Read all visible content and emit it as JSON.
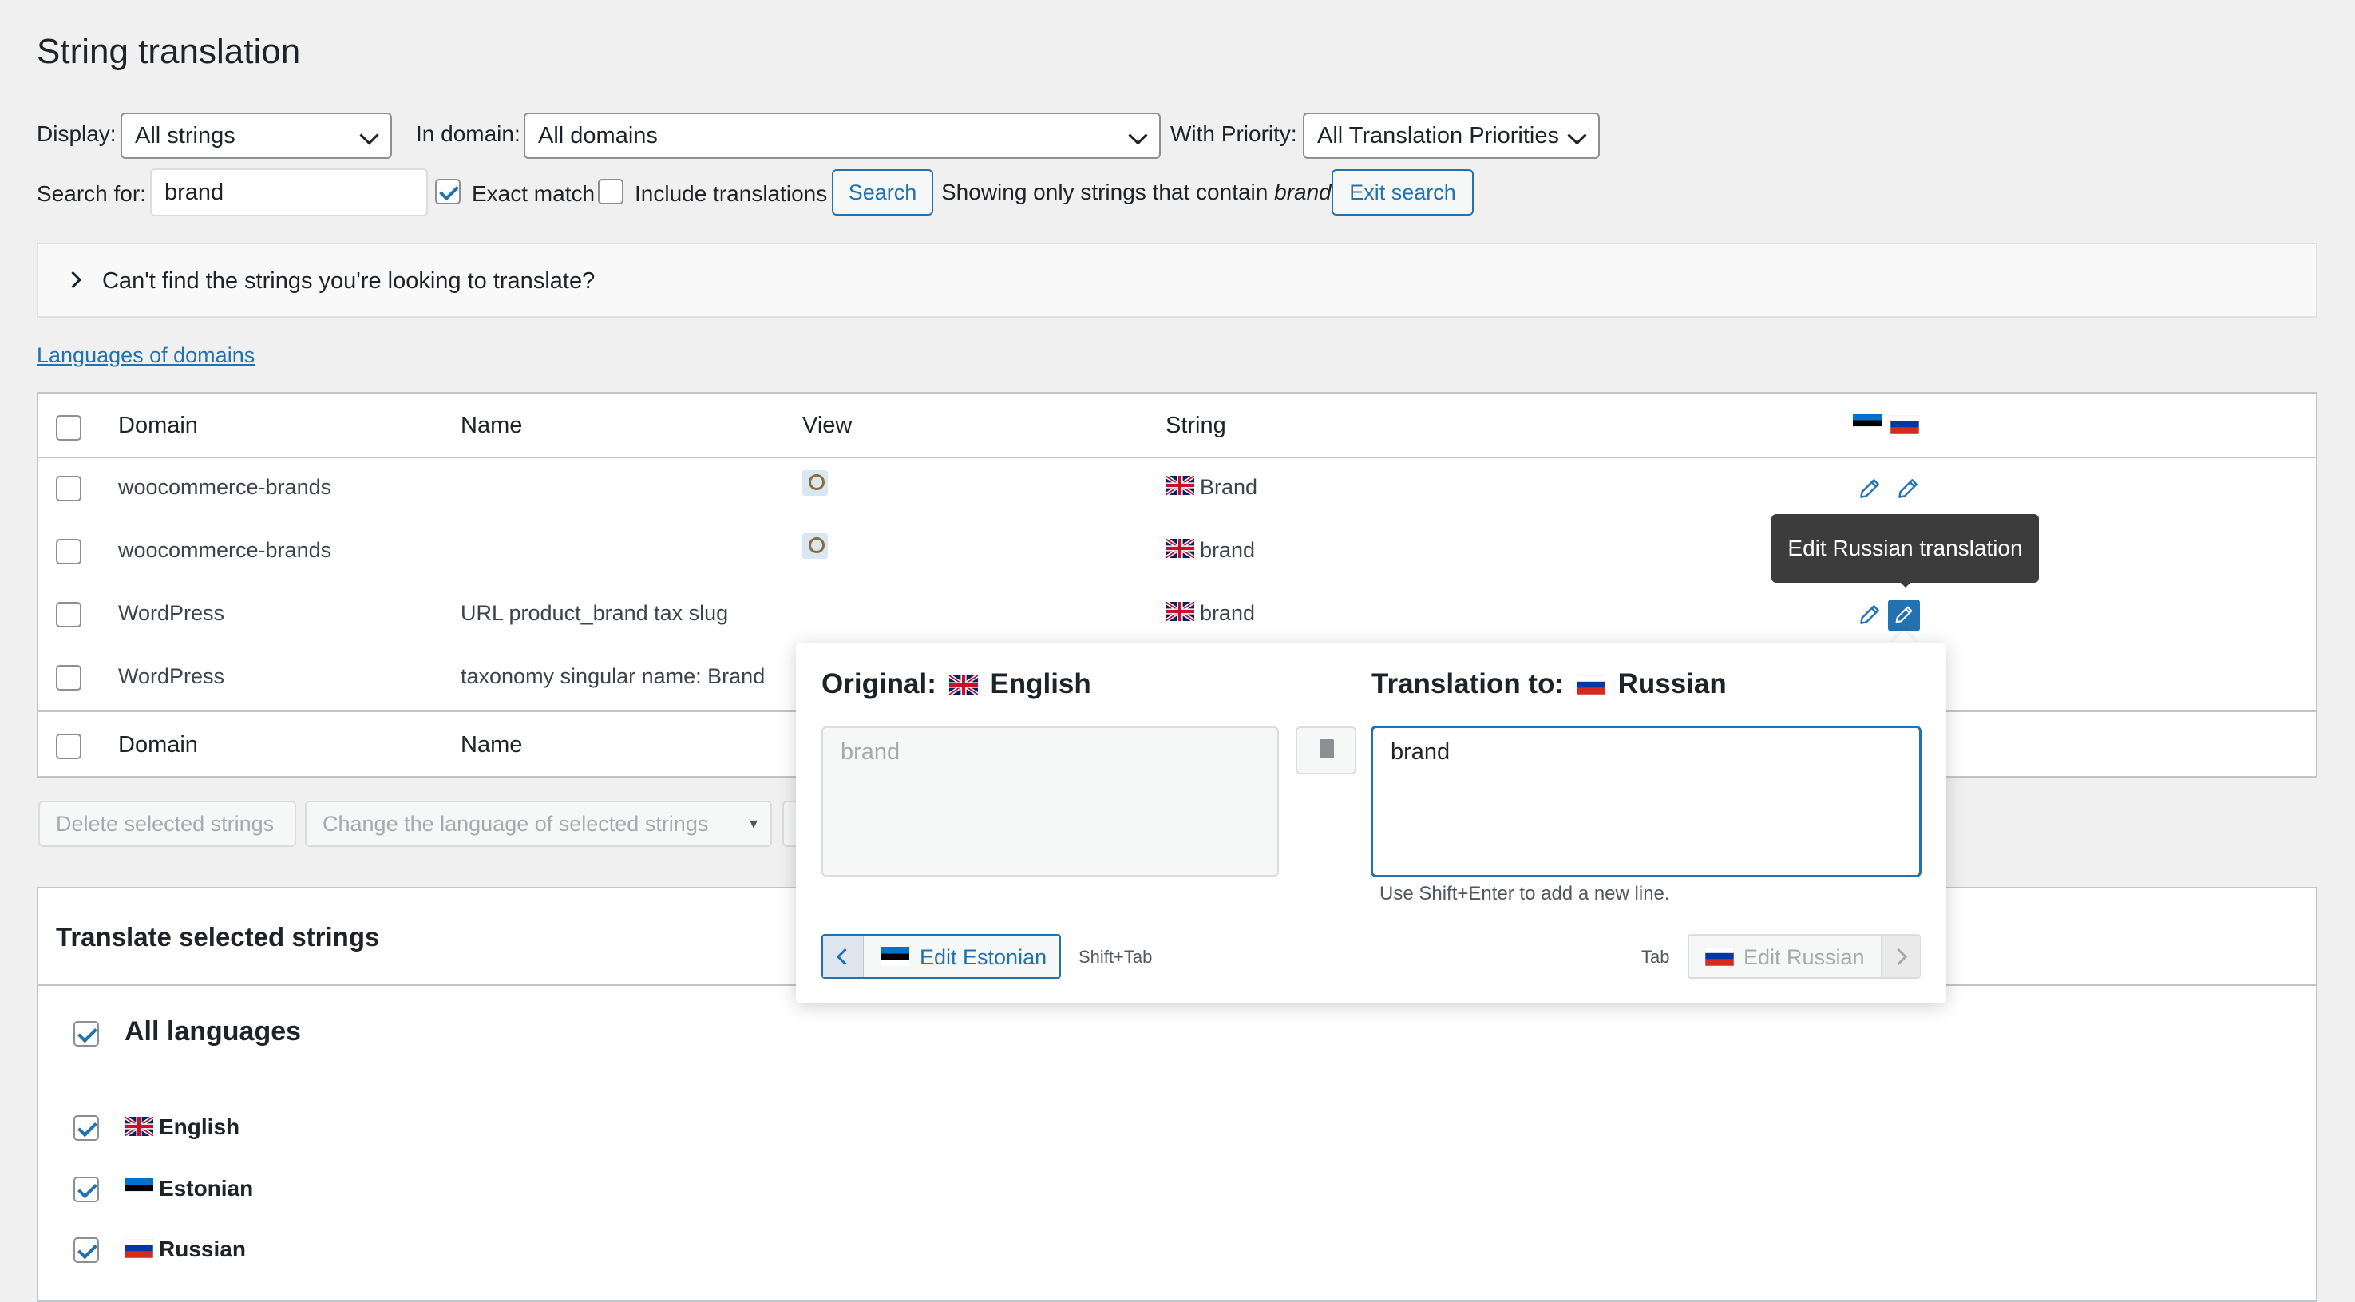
{
  "page": {
    "title": "String translation"
  },
  "filters": {
    "display_label": "Display:",
    "display_value": "All strings",
    "domain_label": "In domain:",
    "domain_value": "All domains",
    "priority_label": "With Priority:",
    "priority_value": "All Translation Priorities",
    "search_label": "Search for:",
    "search_value": "brand",
    "exact_match_label": "Exact match",
    "include_translations_label": "Include translations",
    "search_button": "Search",
    "showing_prefix": "Showing only strings that contain",
    "showing_term": "brand",
    "exit_search_button": "Exit search"
  },
  "cant_find": {
    "text": "Can't find the strings you're looking to translate?"
  },
  "languages_link": "Languages of domains",
  "table": {
    "headers": {
      "domain": "Domain",
      "name": "Name",
      "view": "View",
      "string": "String"
    },
    "rows": [
      {
        "domain": "woocommerce-brands",
        "name": "",
        "string": "Brand"
      },
      {
        "domain": "woocommerce-brands",
        "name": "",
        "string": "brand"
      },
      {
        "domain": "WordPress",
        "name": "URL product_brand tax slug",
        "string": "brand"
      },
      {
        "domain": "WordPress",
        "name": "taxonomy singular name: Brand",
        "string": ""
      }
    ],
    "footer": {
      "domain": "Domain",
      "name": "Name"
    }
  },
  "tooltip": "Edit Russian translation",
  "bulk": {
    "delete_button": "Delete selected strings",
    "change_language_select": "Change the language of selected strings"
  },
  "translate_selected": {
    "title": "Translate selected strings",
    "all_languages": "All languages",
    "languages": [
      "English",
      "Estonian",
      "Russian"
    ]
  },
  "popup": {
    "original_label": "Original:",
    "original_lang": "English",
    "original_text": "brand",
    "translation_label": "Translation to:",
    "translation_lang": "Russian",
    "translation_text": "brand",
    "hint": "Use Shift+Enter to add a new line.",
    "prev_button": "Edit Estonian",
    "prev_shortcut": "Shift+Tab",
    "next_shortcut": "Tab",
    "next_button": "Edit Russian"
  },
  "colors": {
    "accent": "#2271b1",
    "tooltip_bg": "#3c3c3c",
    "background": "#f0f0f1"
  }
}
